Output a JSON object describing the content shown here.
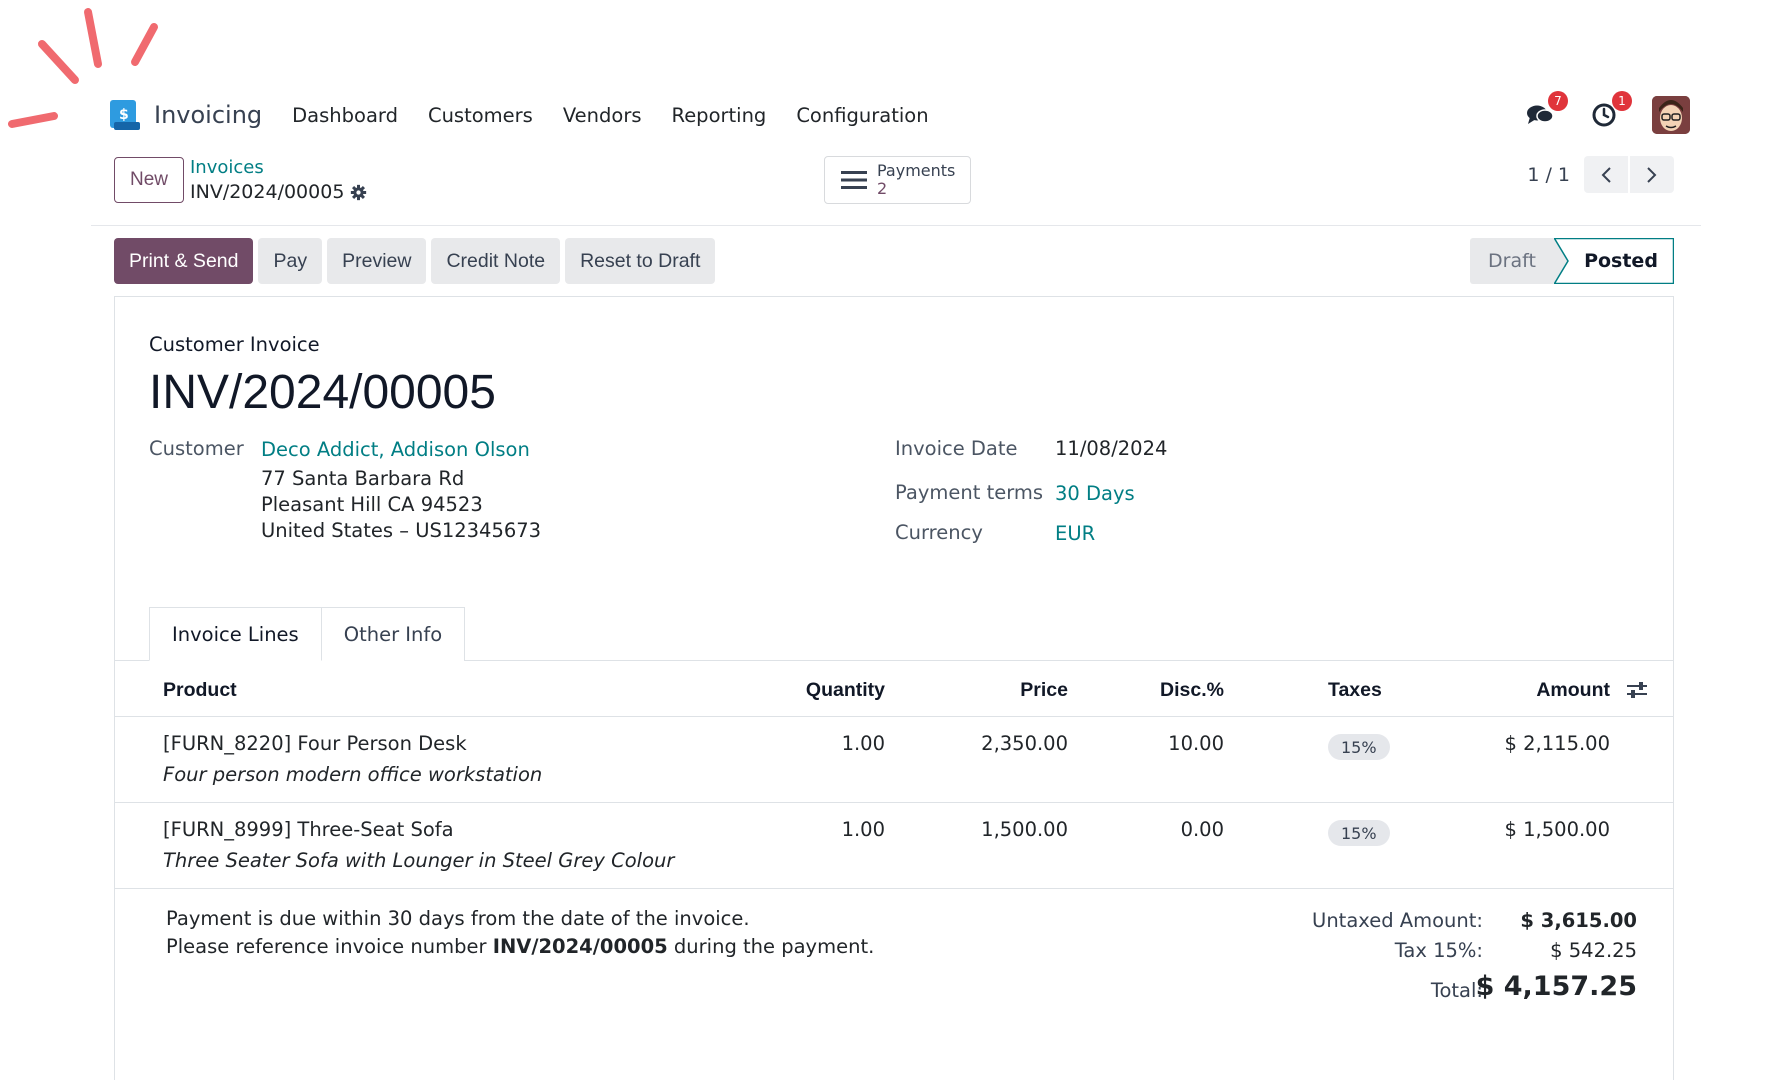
{
  "app": {
    "title": "Invoicing"
  },
  "nav": {
    "items": [
      "Dashboard",
      "Customers",
      "Vendors",
      "Reporting",
      "Configuration"
    ],
    "messages_badge": "7",
    "activities_badge": "1"
  },
  "control": {
    "new_label": "New",
    "breadcrumb_parent": "Invoices",
    "breadcrumb_current": "INV/2024/00005",
    "smart_button": {
      "label": "Payments",
      "value": "2"
    },
    "pager": "1 / 1"
  },
  "actions": [
    "Print & Send",
    "Pay",
    "Preview",
    "Credit Note",
    "Reset to Draft"
  ],
  "status": {
    "draft": "Draft",
    "posted": "Posted",
    "current": "Posted"
  },
  "invoice": {
    "type": "Customer Invoice",
    "name": "INV/2024/00005",
    "customer_label": "Customer",
    "customer": "Deco Addict, Addison Olson",
    "address1": "77 Santa Barbara Rd",
    "address2": "Pleasant Hill CA 94523",
    "address3": "United States – US12345673",
    "invoice_date_label": "Invoice Date",
    "invoice_date": "11/08/2024",
    "payment_terms_label": "Payment terms",
    "payment_terms": "30 Days",
    "currency_label": "Currency",
    "currency": "EUR"
  },
  "tabs": [
    "Invoice Lines",
    "Other Info"
  ],
  "table": {
    "headers": {
      "product": "Product",
      "quantity": "Quantity",
      "price": "Price",
      "disc": "Disc.%",
      "taxes": "Taxes",
      "amount": "Amount"
    },
    "rows": [
      {
        "product": "[FURN_8220] Four Person Desk",
        "description": "Four person modern office workstation",
        "quantity": "1.00",
        "price": "2,350.00",
        "disc": "10.00",
        "taxes": "15%",
        "amount": "$ 2,115.00"
      },
      {
        "product": "[FURN_8999] Three-Seat Sofa",
        "description": "Three Seater Sofa with Lounger in Steel Grey Colour",
        "quantity": "1.00",
        "price": "1,500.00",
        "disc": "0.00",
        "taxes": "15%",
        "amount": "$ 1,500.00"
      }
    ]
  },
  "notes": {
    "line1": "Payment is due within 30 days from the date of the invoice.",
    "line2_prefix": "Please reference invoice number ",
    "line2_ref": "INV/2024/00005",
    "line2_suffix": " during the payment."
  },
  "totals": {
    "untaxed_label": "Untaxed Amount:",
    "untaxed": "$ 3,615.00",
    "tax_label": "Tax 15%:",
    "tax": "$ 542.25",
    "total_label": "Total:",
    "total": "$ 4,157.25"
  },
  "colors": {
    "brand": "#714b67",
    "link": "#017e84",
    "badge": "#e0343b",
    "deco": "#f06a6f"
  }
}
